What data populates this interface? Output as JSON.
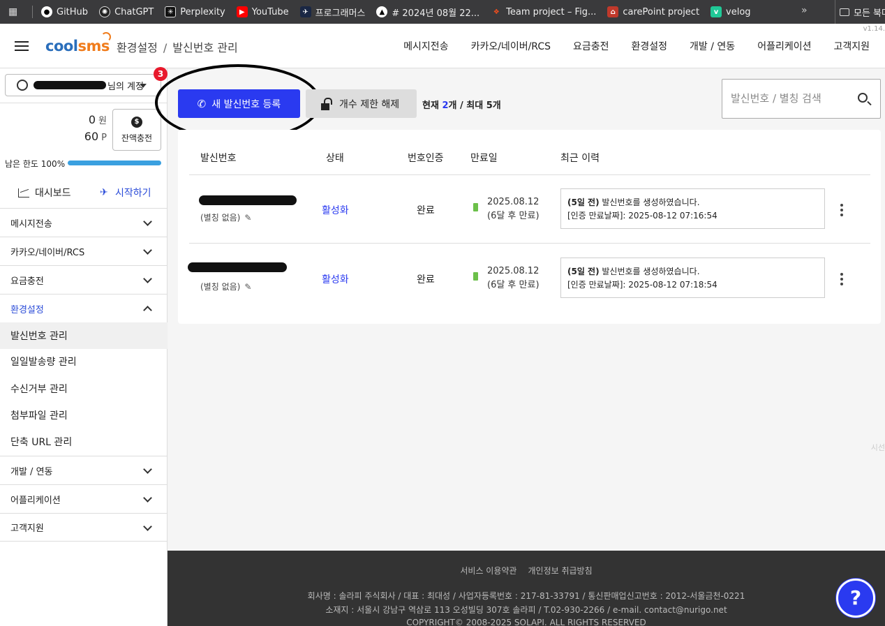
{
  "bookmarks": {
    "items": [
      {
        "label": "GitHub",
        "icon": "github-icon",
        "color": "#ffffff"
      },
      {
        "label": "ChatGPT",
        "icon": "chatgpt-icon",
        "color": "#ffffff"
      },
      {
        "label": "Perplexity",
        "icon": "perplexity-icon",
        "color": "#222222"
      },
      {
        "label": "YouTube",
        "icon": "youtube-icon",
        "color": "#ff0000"
      },
      {
        "label": "프로그래머스",
        "icon": "programmers-icon",
        "color": "#1a2744"
      },
      {
        "label": "# 2024년 08월 22...",
        "icon": "triangle-icon",
        "color": "#000000"
      },
      {
        "label": "Team project – Fig...",
        "icon": "figma-icon",
        "color": "#a259ff"
      },
      {
        "label": "carePoint project",
        "icon": "carepoint-icon",
        "color": "#c0392b"
      },
      {
        "label": "velog",
        "icon": "velog-icon",
        "color": "#20c997"
      }
    ],
    "more": "»",
    "all": "모든 북마크"
  },
  "header": {
    "logo_part1": "cool",
    "logo_part2": "sms",
    "breadcrumb": [
      "환경설정",
      "발신번호 관리"
    ],
    "nav": [
      "메시지전송",
      "카카오/네이버/RCS",
      "요금충전",
      "환경설정",
      "개발 / 연동",
      "어플리케이션",
      "고객지원"
    ],
    "version": "v1.14."
  },
  "sidebar": {
    "account_suffix": "님의 계정",
    "badge": "3",
    "balance_won": "0",
    "won_unit": "원",
    "balance_point": "60",
    "point_unit": "P",
    "charge_label": "잔액충전",
    "limit_label": "남은 한도 100%",
    "limit_percent": 100,
    "dashboard": "대시보드",
    "start": "시작하기",
    "menus": [
      {
        "label": "메시지전송"
      },
      {
        "label": "카카오/네이버/RCS"
      },
      {
        "label": "요금충전"
      },
      {
        "label": "환경설정"
      }
    ],
    "sub_items": [
      "발신번호 관리",
      "일일발송량 관리",
      "수신거부 관리",
      "첨부파일 관리",
      "단축 URL 관리"
    ],
    "menus_after": [
      {
        "label": "개발 / 연동"
      },
      {
        "label": "어플리케이션"
      },
      {
        "label": "고객지원"
      }
    ]
  },
  "main": {
    "new_button": "새 발신번호 등록",
    "unlock_button": "개수 제한 해제",
    "count_prefix": "현재 ",
    "count_current": "2",
    "count_middle": "개 / 최대 ",
    "count_max": "5",
    "count_suffix": "개",
    "search_placeholder": "발신번호 / 별칭 검색",
    "columns": [
      "발신번호",
      "상태",
      "번호인증",
      "만료일",
      "최근 이력"
    ],
    "rows": [
      {
        "alias": "(별칭 없음)",
        "status": "활성화",
        "verified": "완료",
        "expire_date": "2025.08.12",
        "expire_rel": "(6달 후 만료)",
        "history_strong": "(5일 전)",
        "history_line1": " 발신번호를 생성하였습니다.",
        "history_line2": "[인증 만료날짜]: 2025-08-12 07:16:54"
      },
      {
        "alias": "(별칭 없음)",
        "status": "활성화",
        "verified": "완료",
        "expire_date": "2025.08.12",
        "expire_rel": "(6달 후 만료)",
        "history_strong": "(5일 전)",
        "history_line1": " 발신번호를 생성하였습니다.",
        "history_line2": "[인증 만료날짜]: 2025-08-12 07:18:54"
      }
    ]
  },
  "footer": {
    "links": [
      "서비스 이용약관",
      "개인정보 취급방침"
    ],
    "line1": "회사명 : 솔라피 주식회사 / 대표 : 최대성 / 사업자등록번호 : 217-81-33791 / 통신판매업신고번호 : 2012-서울금천-0221",
    "line2": "소재지 : 서울시 강남구 역삼로 113 오성빌딩 307호 솔라피 / T.02-930-2266 / e-mail. contact@nurigo.net",
    "line3": "COPYRIGHT© 2008-2025 SOLAPI. ALL RIGHTS RESERVED"
  },
  "help_label": "?",
  "side_hint": "시선"
}
